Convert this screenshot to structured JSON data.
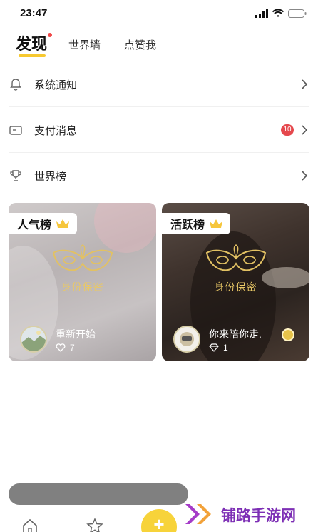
{
  "status_bar": {
    "time": "23:47"
  },
  "tabs": {
    "main": "发现",
    "second": "世界墙",
    "third": "点赞我"
  },
  "menu": [
    {
      "label": "系统通知",
      "icon": "bell-icon"
    },
    {
      "label": "支付消息",
      "icon": "wallet-icon",
      "badge": "10"
    },
    {
      "label": "世界榜",
      "icon": "trophy-icon"
    }
  ],
  "cards": [
    {
      "title": "人气榜",
      "identity": "身份保密",
      "user": "重新开始",
      "stat": "7",
      "stat_icon": "heart-icon"
    },
    {
      "title": "活跃榜",
      "identity": "身份保密",
      "user": "你来陪你走.",
      "stat": "1",
      "stat_icon": "diamond-icon"
    }
  ],
  "fab": {
    "label": "+"
  },
  "watermark": {
    "text": "铺路手游网"
  },
  "colors": {
    "accent": "#f7c930",
    "badge": "#e5484d",
    "gold_text": "#e9c866",
    "watermark": "#7d2fb5"
  }
}
